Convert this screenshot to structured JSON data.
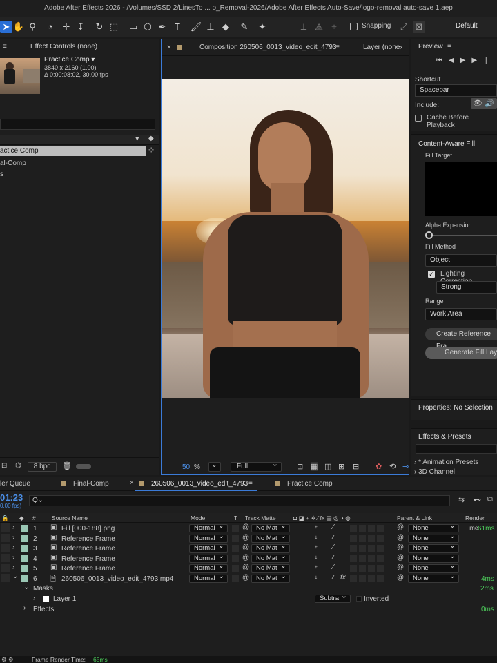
{
  "app": {
    "title": "Adobe After Effects 2026 - /Volumes/SSD 2/LinesTo ... o_Removal-2026/Adobe After Effects Auto-Save/logo-removal auto-save 1.aep"
  },
  "toolbar": {
    "snapping_label": "Snapping",
    "workspace_label": "Default"
  },
  "project_panel": {
    "tab_label": "Effect Controls (none)",
    "item_name": "Practice Comp ▾",
    "item_res": "3840 x 2160 (1.00)",
    "item_dur": "Δ 0:00:08:02, 30.00 fps",
    "items": [
      {
        "name": "actice Comp"
      },
      {
        "name": "al-Comp"
      },
      {
        "name": "s"
      }
    ],
    "bpc_label": "8 bpc"
  },
  "comp_panel": {
    "tab_label": "Composition 260506_0013_video_edit_4793",
    "layer_tab": "Layer (none",
    "zoom_value": "50",
    "zoom_unit": "%",
    "resolution": "Full"
  },
  "preview_panel": {
    "title": "Preview",
    "shortcut_label": "Shortcut",
    "shortcut_value": "Spacebar",
    "include_label": "Include:",
    "cache_label": "Cache Before Playback"
  },
  "caf_panel": {
    "title": "Content-Aware Fill",
    "fill_target_label": "Fill Target",
    "alpha_expansion_label": "Alpha Expansion",
    "fill_method_label": "Fill Method",
    "fill_method_value": "Object",
    "lighting_label": "Lighting Correction",
    "lighting_value": "Strong",
    "range_label": "Range",
    "range_value": "Work Area",
    "create_ref_label": "Create Reference Fra",
    "generate_label": "Generate Fill Laye"
  },
  "properties_panel": {
    "title": "Properties: No Selection"
  },
  "effects_panel": {
    "title": "Effects & Presets",
    "item1": "* Animation Presets",
    "item2": "3D Channel"
  },
  "timeline": {
    "tabs": [
      "ler Queue",
      "Final-Comp",
      "260506_0013_video_edit_4793",
      "Practice Comp"
    ],
    "timecode": "01:23",
    "fps": "0.00 fps)",
    "search_placeholder": "Q⌄",
    "columns": {
      "num": "#",
      "source": "Source Name",
      "mode": "Mode",
      "t": "T",
      "matte": "Track Matte",
      "parent": "Parent & Link",
      "render": "Render Time"
    },
    "layers": [
      {
        "num": "1",
        "name": "Fill [000-188].png",
        "mode": "Normal",
        "matte": "No Mat",
        "parent": "None",
        "render": "61ms",
        "color": "#9ac7b4"
      },
      {
        "num": "2",
        "name": "Reference Frame",
        "mode": "Normal",
        "matte": "No Mat",
        "parent": "None",
        "render": "",
        "color": "#9ac7b4"
      },
      {
        "num": "3",
        "name": "Reference Frame",
        "mode": "Normal",
        "matte": "No Mat",
        "parent": "None",
        "render": "",
        "color": "#9ac7b4"
      },
      {
        "num": "4",
        "name": "Reference Frame",
        "mode": "Normal",
        "matte": "No Mat",
        "parent": "None",
        "render": "",
        "color": "#9ac7b4"
      },
      {
        "num": "5",
        "name": "Reference Frame",
        "mode": "Normal",
        "matte": "No Mat",
        "parent": "None",
        "render": "",
        "color": "#9ac7b4"
      },
      {
        "num": "6",
        "name": "260506_0013_video_edit_4793.mp4",
        "mode": "Normal",
        "matte": "No Mat",
        "parent": "None",
        "render": "4ms",
        "color": "#9ac7b4"
      }
    ],
    "masks_label": "Masks",
    "masks_time": "2ms",
    "mask_layer": "Layer 1",
    "mask_mode": "Subtra",
    "mask_inverted": "Inverted",
    "effects_label": "Effects",
    "effects_time": "0ms",
    "frame_render_label": "Frame Render Time:",
    "frame_render_value": "65ms"
  },
  "colors": {
    "accent": "#2a6fd6",
    "panel_border_active": "#3b7bd8",
    "render_green": "#4cc95a"
  }
}
